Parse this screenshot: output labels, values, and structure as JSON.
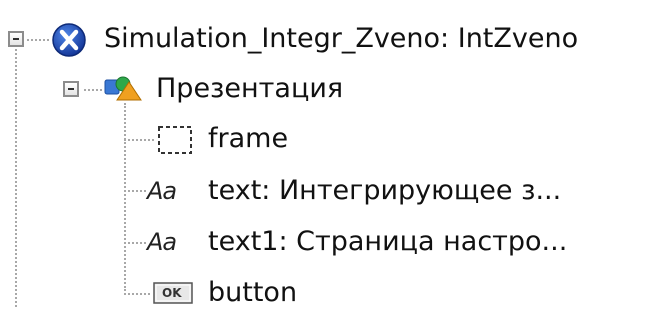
{
  "tree": {
    "root": {
      "label": "Simulation_Integr_Zveno: IntZveno",
      "icon": "agent-x-icon",
      "expanded": true
    },
    "presentation": {
      "label": "Презентация",
      "icon": "presentation-icon",
      "expanded": true
    },
    "children": [
      {
        "label": "frame",
        "icon": "frame-icon"
      },
      {
        "label": "text: Интегрирующее з...",
        "icon": "text-icon",
        "icon_text": "Aa"
      },
      {
        "label": "text1: Страница настро...",
        "icon": "text-icon",
        "icon_text": "Aa"
      },
      {
        "label": "button",
        "icon": "button-icon",
        "icon_text": "OK"
      }
    ]
  },
  "colors": {
    "agent_icon": "#1f57c4",
    "presentation_icon_blue": "#3a78d4",
    "presentation_icon_orange": "#f0a020",
    "guide_lines": "#a8a8a8"
  }
}
